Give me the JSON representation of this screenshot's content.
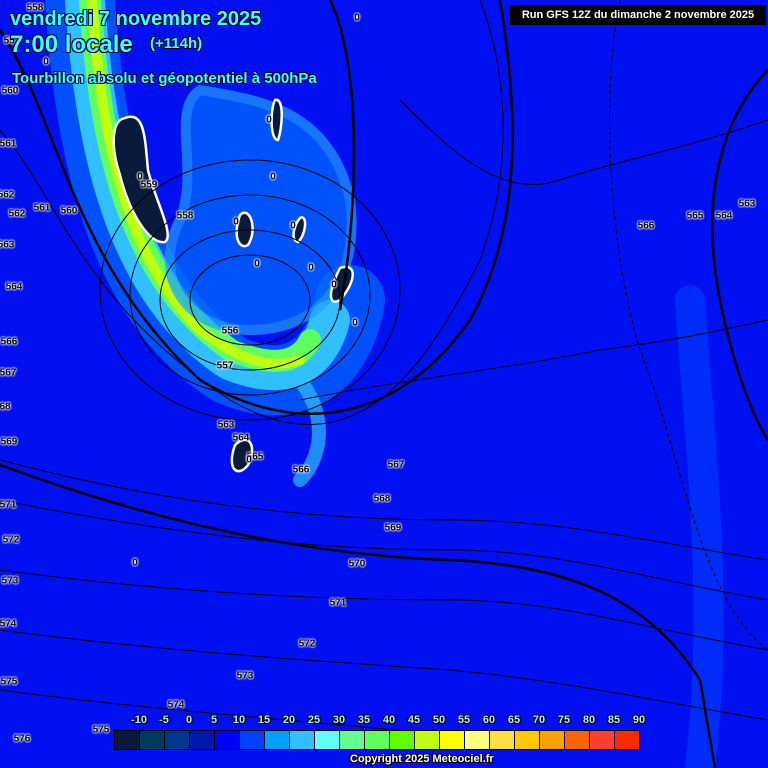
{
  "header": {
    "date": "vendredi 7 novembre 2025",
    "time": "7:00 locale",
    "lead": "(+114h)",
    "field": "Tourbillon absolu et géopotentiel à 500hPa",
    "run": "Run GFS 12Z du dimanche 2 novembre 2025"
  },
  "contour_labels": [
    "558",
    "557",
    "560",
    "561",
    "562",
    "562",
    "561",
    "560",
    "563",
    "564",
    "566",
    "567",
    "68",
    "569",
    "571",
    "572",
    "573",
    "574",
    "575",
    "576",
    "575",
    "574",
    "573",
    "572",
    "571",
    "570",
    "569",
    "568",
    "567",
    "566",
    "565",
    "564",
    "563",
    "557",
    "556",
    "558",
    "559",
    "566",
    "565",
    "564",
    "563"
  ],
  "zero_labels": [
    "0",
    "0",
    "0",
    "0",
    "0",
    "0",
    "0",
    "0",
    "0",
    "0",
    "0",
    "0",
    "0"
  ],
  "legend": {
    "ticks": [
      "-10",
      "-5",
      "0",
      "5",
      "10",
      "15",
      "20",
      "25",
      "30",
      "35",
      "40",
      "45",
      "50",
      "55",
      "60",
      "65",
      "70",
      "75",
      "80",
      "85",
      "90"
    ],
    "colors": [
      "#0a1a3a",
      "#003a60",
      "#003890",
      "#0018b0",
      "#0000ff",
      "#0040ff",
      "#00a0ff",
      "#30c0ff",
      "#60ffff",
      "#60ff90",
      "#60ff60",
      "#60ff00",
      "#c0ff10",
      "#ffff00",
      "#ffff80",
      "#ffe040",
      "#ffc800",
      "#ffa000",
      "#ff6400",
      "#ff4030",
      "#ff2800"
    ]
  },
  "copyright": "Copyright 2025 Meteociel.fr"
}
